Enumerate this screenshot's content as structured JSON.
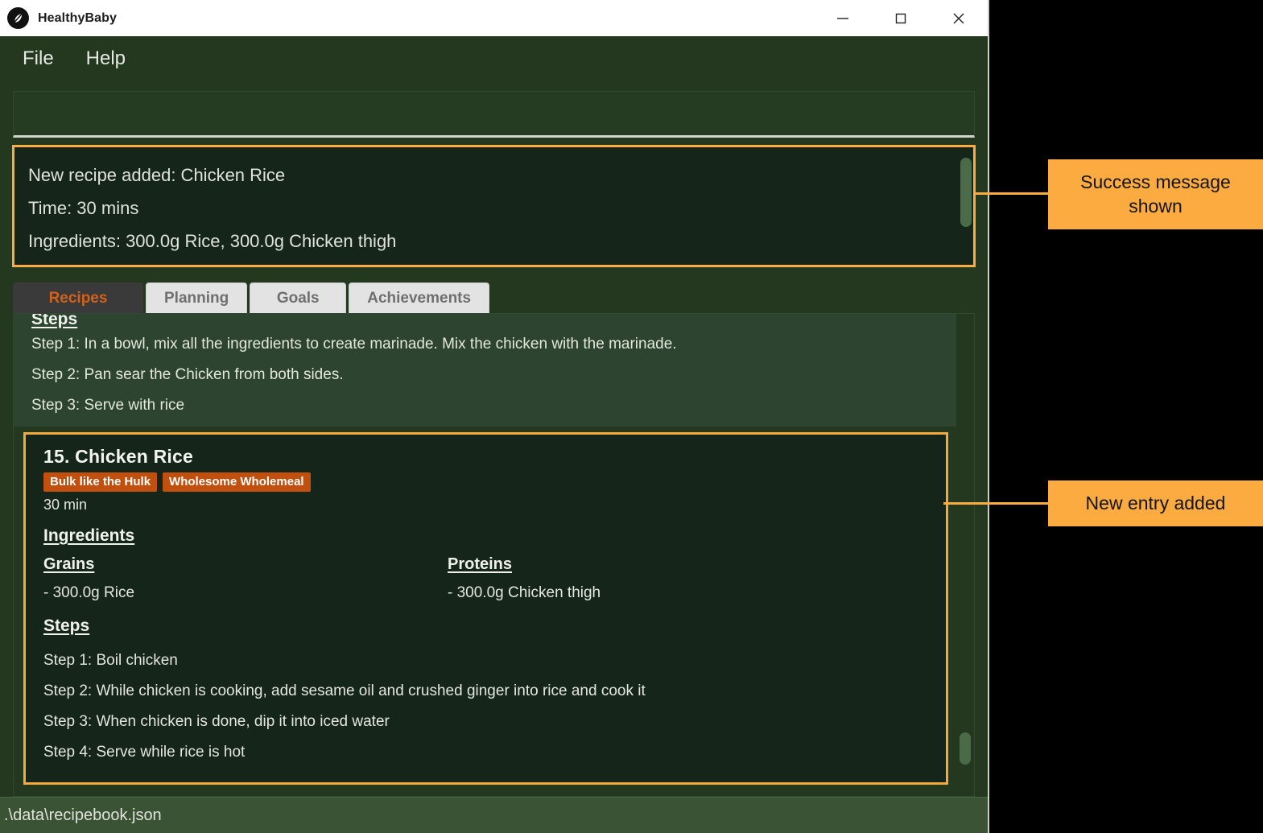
{
  "window": {
    "title": "HealthyBaby",
    "logo_icon": "leaf-icon",
    "controls": {
      "minimize": "minimize-icon",
      "maximize": "maximize-icon",
      "close": "close-icon"
    }
  },
  "menubar": {
    "items": [
      {
        "label": "File"
      },
      {
        "label": "Help"
      }
    ]
  },
  "entry": {
    "value": "",
    "placeholder": ""
  },
  "message_box": {
    "lines": [
      "New recipe added: Chicken Rice",
      "Time: 30 mins",
      "Ingredients: 300.0g Rice, 300.0g Chicken thigh"
    ]
  },
  "tabs": {
    "active": "Recipes",
    "items": [
      {
        "label": "Recipes",
        "active": true
      },
      {
        "label": "Planning",
        "active": false
      },
      {
        "label": "Goals",
        "active": false
      },
      {
        "label": "Achievements",
        "active": false
      }
    ]
  },
  "previous_recipe": {
    "steps_title": "Steps",
    "steps": [
      "Step 1: In a bowl, mix all the ingredients to create marinade. Mix the chicken with the marinade.",
      "Step 2: Pan sear the Chicken from both sides.",
      "Step 3: Serve with rice"
    ]
  },
  "new_recipe": {
    "index": "15.",
    "name": "Chicken Rice",
    "heading": "15.  Chicken Rice",
    "badges": [
      "Bulk like the Hulk",
      "Wholesome Wholemeal"
    ],
    "time": "30 min",
    "ingredients_title": "Ingredients",
    "ingredient_groups": [
      {
        "category": "Grains",
        "items": [
          "- 300.0g Rice"
        ]
      },
      {
        "category": "Proteins",
        "items": [
          "- 300.0g Chicken thigh"
        ]
      }
    ],
    "steps_title": "Steps",
    "steps": [
      "Step 1: Boil chicken",
      "Step 2: While chicken is cooking, add sesame oil and crushed ginger into rice and cook it",
      "Step 3: When chicken is done, dip it into iced water",
      "Step 4: Serve while rice is hot"
    ]
  },
  "statusbar": {
    "path": ".\\data\\recipebook.json"
  },
  "annotations": [
    {
      "label": "Success message\nshown",
      "line1": "Success message",
      "line2": "shown"
    },
    {
      "label": "New entry added",
      "line1": "New entry added",
      "line2": ""
    }
  ],
  "colors": {
    "window_bg": "#24381f",
    "panel_dark": "#16251a",
    "card_prev": "#2d4530",
    "accent_orange": "#fbab3f",
    "badge_orange": "#c1500f",
    "tab_active_text": "#d2611b",
    "tab_active_bg": "#3a3a3a",
    "statusbar_bg": "#3a5335"
  }
}
